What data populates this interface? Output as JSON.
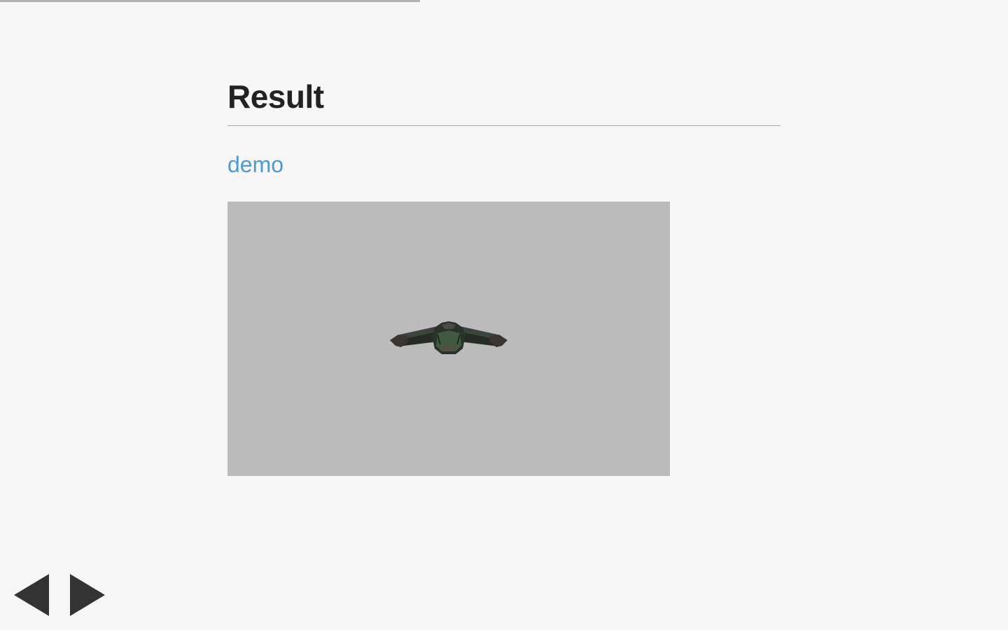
{
  "progress": {
    "fraction": 0.4167,
    "color": "#b3b3b3"
  },
  "slide": {
    "title": "Result",
    "link_text": "demo",
    "link_color": "#4a9bd8"
  },
  "viewport": {
    "background": "#bbbbbb",
    "model": "spaceship-3d-model"
  },
  "navigation": {
    "prev_icon": "triangle-left-icon",
    "next_icon": "triangle-right-icon",
    "arrow_color": "#333333"
  }
}
